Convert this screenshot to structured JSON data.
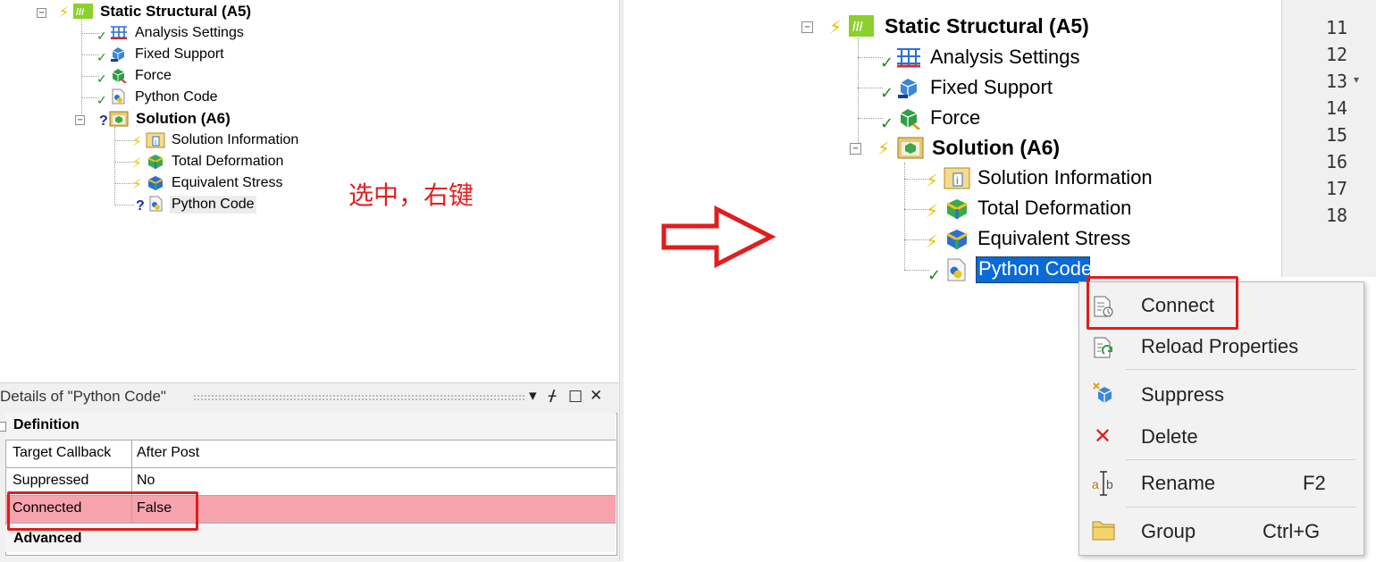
{
  "left_tree": {
    "static_structural": "Static Structural (A5)",
    "analysis_settings": "Analysis Settings",
    "fixed_support": "Fixed Support",
    "force": "Force",
    "python_code_1": "Python Code",
    "solution": "Solution (A6)",
    "solution_information": "Solution Information",
    "total_deformation": "Total Deformation",
    "equivalent_stress": "Equivalent Stress",
    "python_code_2": "Python Code"
  },
  "annotation": "选中，右键",
  "details": {
    "title": "Details of \"Python Code\"",
    "buttons": [
      "▾",
      "ᚋ",
      "□",
      "✕"
    ],
    "definition_header": "Definition",
    "rows": [
      {
        "label": "Target Callback",
        "value": "After Post"
      },
      {
        "label": "Suppressed",
        "value": "No"
      },
      {
        "label": "Connected",
        "value": "False"
      }
    ],
    "advanced_header": "Advanced"
  },
  "right_tree": {
    "static_structural": "Static Structural (A5)",
    "analysis_settings": "Analysis Settings",
    "fixed_support": "Fixed Support",
    "force": "Force",
    "solution": "Solution (A6)",
    "solution_information": "Solution Information",
    "total_deformation": "Total Deformation",
    "equivalent_stress": "Equivalent Stress",
    "python_code": "Python Code"
  },
  "line_numbers": [
    "11",
    "12",
    "13",
    "14",
    "15",
    "16",
    "17",
    "18"
  ],
  "context_menu": {
    "items": [
      {
        "label": "Connect",
        "shortcut": ""
      },
      {
        "label": "Reload Properties",
        "shortcut": ""
      },
      {
        "label": "Suppress",
        "shortcut": ""
      },
      {
        "label": "Delete",
        "shortcut": ""
      },
      {
        "label": "Rename",
        "shortcut": "F2"
      },
      {
        "label": "Group",
        "shortcut": "Ctrl+G"
      }
    ]
  },
  "colors": {
    "highlight_red": "#e11d1d",
    "selection_blue": "#0a6ad6",
    "connected_row": "#f7a3ad",
    "check_green": "#1a8a1a",
    "bolt_yellow": "#e6c000"
  }
}
